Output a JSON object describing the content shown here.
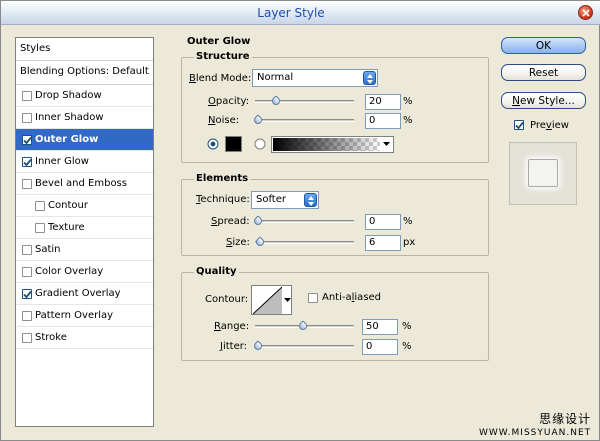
{
  "window": {
    "title": "Layer Style"
  },
  "styles_panel": {
    "header": "Styles",
    "blending_options": "Blending Options: Default",
    "items": [
      {
        "label": "Drop Shadow",
        "checked": false,
        "selected": false,
        "indent": false
      },
      {
        "label": "Inner Shadow",
        "checked": false,
        "selected": false,
        "indent": false
      },
      {
        "label": "Outer Glow",
        "checked": true,
        "selected": true,
        "indent": false
      },
      {
        "label": "Inner Glow",
        "checked": true,
        "selected": false,
        "indent": false
      },
      {
        "label": "Bevel and Emboss",
        "checked": false,
        "selected": false,
        "indent": false
      },
      {
        "label": "Contour",
        "checked": false,
        "selected": false,
        "indent": true
      },
      {
        "label": "Texture",
        "checked": false,
        "selected": false,
        "indent": true
      },
      {
        "label": "Satin",
        "checked": false,
        "selected": false,
        "indent": false
      },
      {
        "label": "Color Overlay",
        "checked": false,
        "selected": false,
        "indent": false
      },
      {
        "label": "Gradient Overlay",
        "checked": true,
        "selected": false,
        "indent": false
      },
      {
        "label": "Pattern Overlay",
        "checked": false,
        "selected": false,
        "indent": false
      },
      {
        "label": "Stroke",
        "checked": false,
        "selected": false,
        "indent": false
      }
    ]
  },
  "outer_glow": {
    "title": "Outer Glow",
    "structure": {
      "title": "Structure",
      "blend_mode_label": "Blend Mode:",
      "blend_mode_value": "Normal",
      "opacity_label": "Opacity:",
      "opacity_value": "20",
      "opacity_fraction": 0.2,
      "noise_label": "Noise:",
      "noise_value": "0",
      "noise_fraction": 0,
      "percent": "%",
      "solid_color_selected": true,
      "glow_color": "#000000"
    },
    "elements": {
      "title": "Elements",
      "technique_label": "Technique:",
      "technique_value": "Softer",
      "spread_label": "Spread:",
      "spread_value": "0",
      "spread_fraction": 0,
      "size_label": "Size:",
      "size_value": "6",
      "size_fraction": 0.024,
      "percent": "%",
      "px": "px"
    },
    "quality": {
      "title": "Quality",
      "contour_label": "Contour:",
      "anti_aliased_label": "Anti-aliased",
      "anti_aliased_checked": false,
      "range_label": "Range:",
      "range_value": "50",
      "range_fraction": 0.5,
      "jitter_label": "Jitter:",
      "jitter_value": "0",
      "jitter_fraction": 0,
      "percent": "%"
    }
  },
  "buttons": {
    "ok": "OK",
    "reset": "Reset",
    "new_style": "New Style...",
    "preview_label": "Preview",
    "preview_checked": true
  },
  "watermark": {
    "chinese": "思缘设计",
    "site": "WWW.MISSYUAN.NET"
  },
  "colors": {
    "selection": "#3169c6",
    "title_text": "#1f4fa8",
    "dialog_bg": "#ece9d8"
  }
}
